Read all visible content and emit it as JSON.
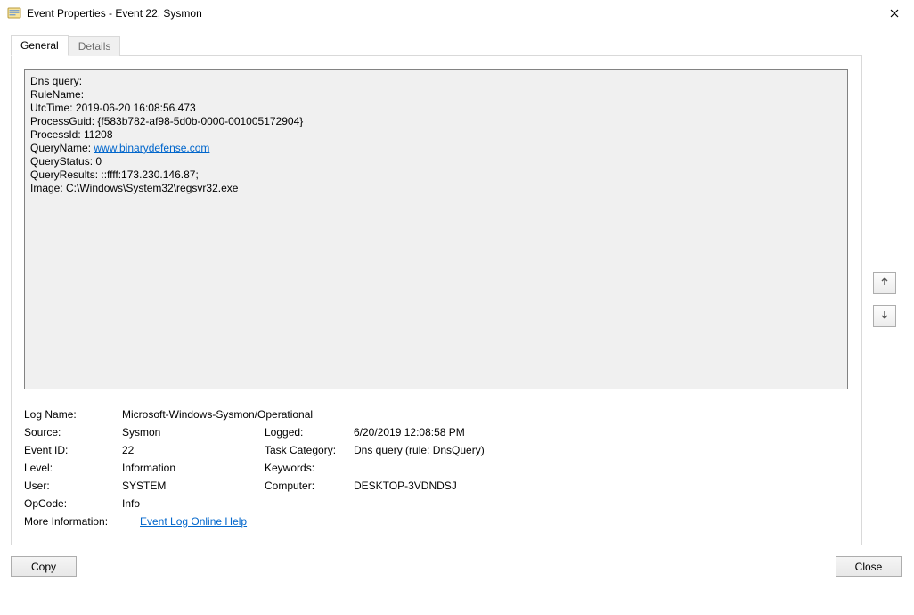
{
  "window": {
    "title": "Event Properties - Event 22, Sysmon"
  },
  "tabs": {
    "general": "General",
    "details": "Details"
  },
  "event_text": {
    "l1": "Dns query:",
    "l2": "RuleName:",
    "l3": "UtcTime: 2019-06-20 16:08:56.473",
    "l4": "ProcessGuid: {f583b782-af98-5d0b-0000-001005172904}",
    "l5": "ProcessId: 11208",
    "l6_pre": "QueryName: ",
    "l6_link": "www.binarydefense.com",
    "l7": "QueryStatus: 0",
    "l8": "QueryResults: ::ffff:173.230.146.87;",
    "l9": "Image: C:\\Windows\\System32\\regsvr32.exe"
  },
  "info": {
    "log_name_label": "Log Name:",
    "log_name_value": "Microsoft-Windows-Sysmon/Operational",
    "source_label": "Source:",
    "source_value": "Sysmon",
    "logged_label": "Logged:",
    "logged_value": "6/20/2019 12:08:58 PM",
    "event_id_label": "Event ID:",
    "event_id_value": "22",
    "task_cat_label": "Task Category:",
    "task_cat_value": "Dns query (rule: DnsQuery)",
    "level_label": "Level:",
    "level_value": "Information",
    "keywords_label": "Keywords:",
    "keywords_value": "",
    "user_label": "User:",
    "user_value": "SYSTEM",
    "computer_label": "Computer:",
    "computer_value": "DESKTOP-3VDNDSJ",
    "opcode_label": "OpCode:",
    "opcode_value": "Info",
    "more_info_label": "More Information:",
    "more_info_link": "Event Log Online Help"
  },
  "buttons": {
    "copy": "Copy",
    "close": "Close"
  }
}
